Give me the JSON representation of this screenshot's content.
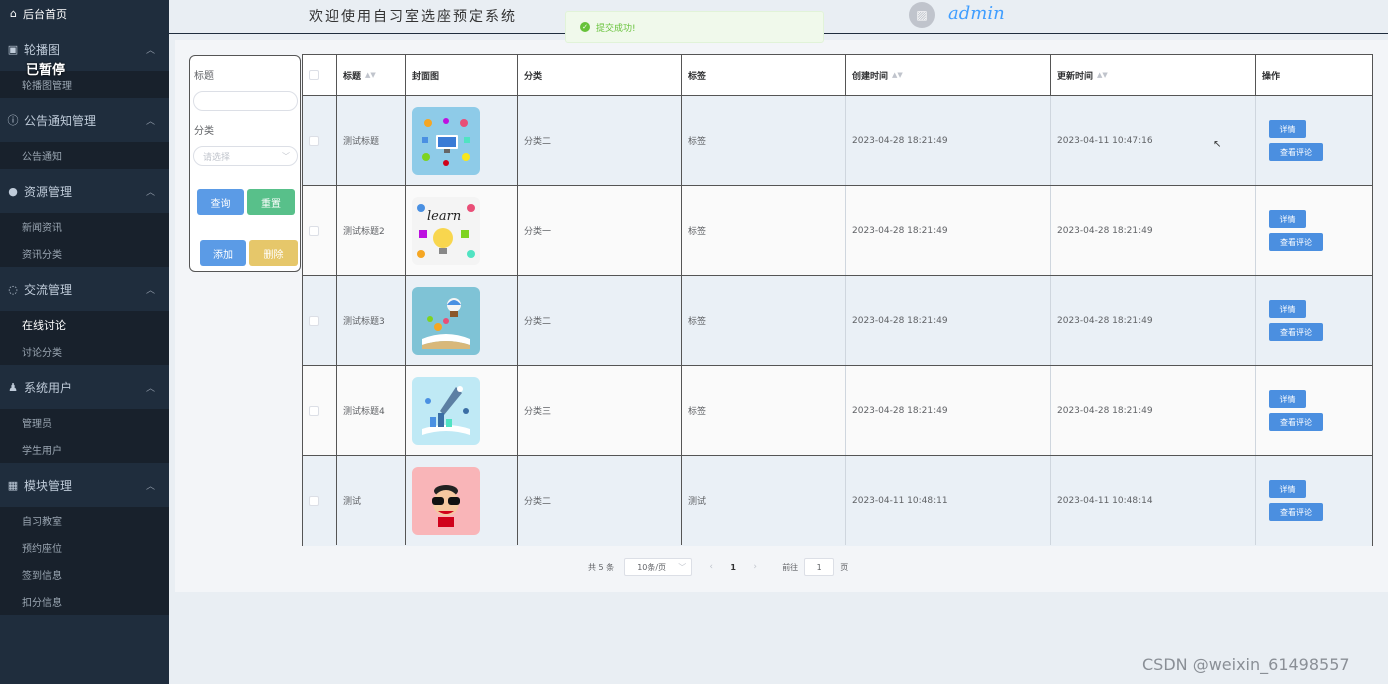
{
  "sidebar": {
    "home": "后台首页",
    "paused": "已暂停",
    "groups": [
      {
        "title": "轮播图",
        "items": [
          "轮播图管理"
        ]
      },
      {
        "title": "公告通知管理",
        "items": [
          "公告通知"
        ]
      },
      {
        "title": "资源管理",
        "items": [
          "新闻资讯",
          "资讯分类"
        ]
      },
      {
        "title": "交流管理",
        "items": [
          "在线讨论",
          "讨论分类"
        ]
      },
      {
        "title": "系统用户",
        "items": [
          "管理员",
          "学生用户"
        ]
      },
      {
        "title": "模块管理",
        "items": [
          "自习教室",
          "预约座位",
          "签到信息",
          "扣分信息"
        ]
      }
    ]
  },
  "header": {
    "welcome": "欢迎使用自习室选座预定系统",
    "toast": "提交成功!",
    "username": "admin"
  },
  "search": {
    "title_label": "标题",
    "category_label": "分类",
    "category_placeholder": "请选择",
    "query_btn": "查询",
    "reset_btn": "重置",
    "add_btn": "添加",
    "delete_btn": "删除"
  },
  "table": {
    "headers": {
      "title": "标题",
      "cover": "封面图",
      "category": "分类",
      "tag": "标签",
      "created": "创建时间",
      "updated": "更新时间",
      "ops": "操作"
    },
    "detail_btn": "详情",
    "comment_btn": "查看评论",
    "rows": [
      {
        "title": "测试标题",
        "category": "分类二",
        "tag": "标签",
        "created": "2023-04-28 18:21:49",
        "updated": "2023-04-11 10:47:16"
      },
      {
        "title": "测试标题2",
        "category": "分类一",
        "tag": "标签",
        "created": "2023-04-28 18:21:49",
        "updated": "2023-04-28 18:21:49"
      },
      {
        "title": "测试标题3",
        "category": "分类二",
        "tag": "标签",
        "created": "2023-04-28 18:21:49",
        "updated": "2023-04-28 18:21:49"
      },
      {
        "title": "测试标题4",
        "category": "分类三",
        "tag": "标签",
        "created": "2023-04-28 18:21:49",
        "updated": "2023-04-28 18:21:49"
      },
      {
        "title": "测试",
        "category": "分类二",
        "tag": "测试",
        "created": "2023-04-11 10:48:11",
        "updated": "2023-04-11 10:48:14"
      }
    ]
  },
  "pager": {
    "total": "共 5 条",
    "page_size": "10条/页",
    "current": "1",
    "goto": "前往",
    "goto_value": "1",
    "page_unit": "页"
  },
  "watermark": "CSDN @weixin_61498557"
}
